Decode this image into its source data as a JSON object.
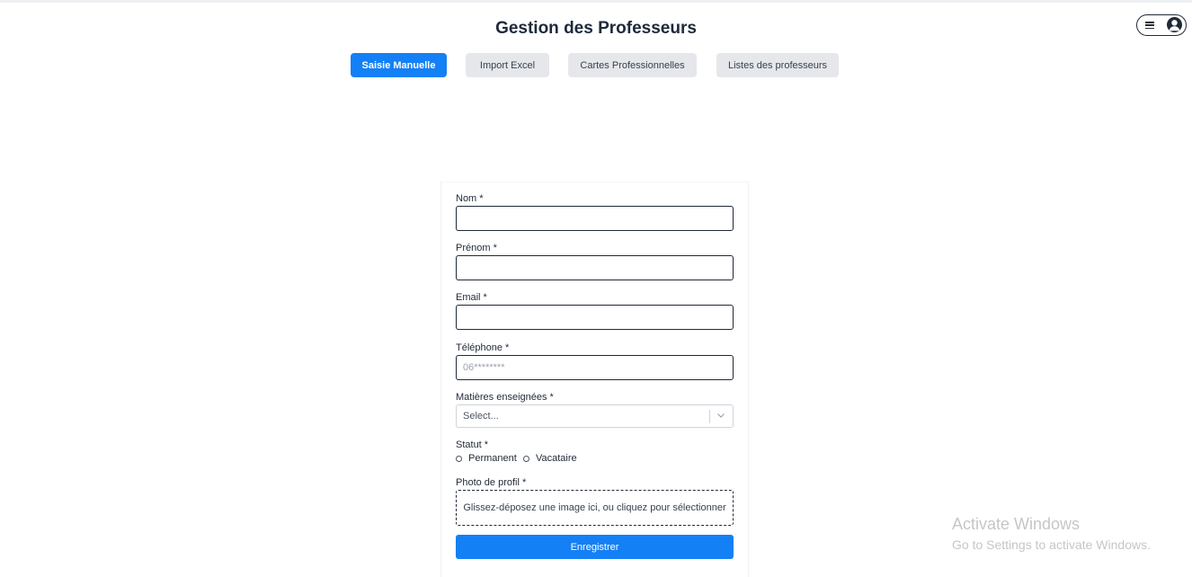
{
  "header": {
    "title": "Gestion des Professeurs"
  },
  "tabs": [
    {
      "label": "Saisie Manuelle",
      "active": true
    },
    {
      "label": "Import Excel",
      "active": false
    },
    {
      "label": "Cartes Professionnelles",
      "active": false
    },
    {
      "label": "Listes des professeurs",
      "active": false
    }
  ],
  "user_menu": {
    "icons": [
      "hamburger-icon",
      "user-avatar-icon"
    ]
  },
  "form": {
    "nom": {
      "label": "Nom *",
      "value": ""
    },
    "prenom": {
      "label": "Prénom *",
      "value": ""
    },
    "email": {
      "label": "Email *",
      "value": ""
    },
    "telephone": {
      "label": "Téléphone *",
      "placeholder": "06********",
      "value": ""
    },
    "matieres": {
      "label": "Matières enseignées *",
      "placeholder": "Select..."
    },
    "statut": {
      "label": "Statut *",
      "options": [
        "Permanent",
        "Vacataire"
      ]
    },
    "photo": {
      "label": "Photo de profil *",
      "dropzone_text": "Glissez-déposez une image ici, ou cliquez pour sélectionner"
    },
    "submit_label": "Enregistrer"
  },
  "watermark": {
    "title": "Activate Windows",
    "subtitle": "Go to Settings to activate Windows."
  },
  "colors": {
    "accent": "#1480f5",
    "tab_inactive": "#e5e7eb",
    "text_dark": "#1e293b"
  }
}
